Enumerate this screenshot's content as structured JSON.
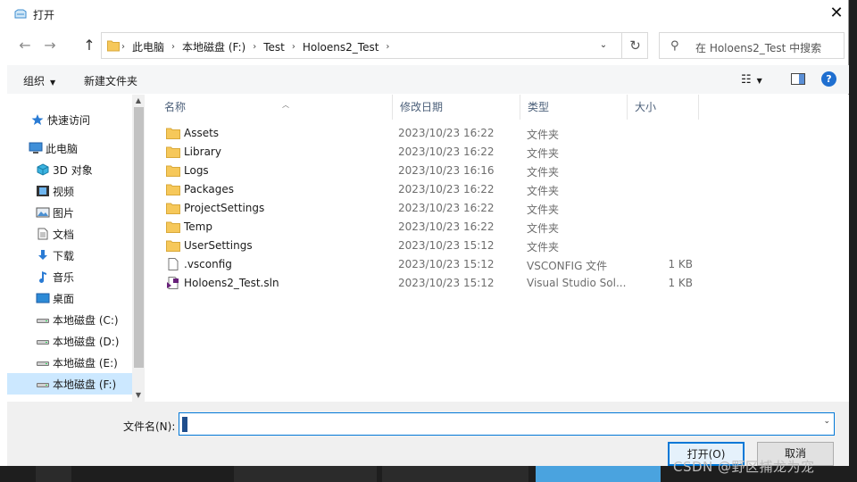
{
  "window": {
    "title": "打开",
    "close_glyph": "✕"
  },
  "nav_buttons": {
    "back": "←",
    "forward": "→",
    "up": "↑"
  },
  "address": {
    "crumbs": [
      "此电脑",
      "本地磁盘 (F:)",
      "Test",
      "Holoens2_Test"
    ],
    "separator": "›",
    "dropdown_glyph": "⌄",
    "refresh_glyph": "↻"
  },
  "search": {
    "placeholder": "在 Holoens2_Test 中搜索",
    "icon_glyph": "⚲"
  },
  "toolbar": {
    "organize": "组织",
    "new_folder": "新建文件夹",
    "view_glyph": "☷",
    "help_glyph": "?"
  },
  "sidebar": {
    "items": [
      {
        "label": "快速访问",
        "icon": "star-icon"
      },
      {
        "label": "此电脑",
        "icon": "computer-icon"
      },
      {
        "label": "3D 对象",
        "icon": "cube-icon"
      },
      {
        "label": "视频",
        "icon": "video-icon"
      },
      {
        "label": "图片",
        "icon": "picture-icon"
      },
      {
        "label": "文档",
        "icon": "document-icon"
      },
      {
        "label": "下载",
        "icon": "download-icon"
      },
      {
        "label": "音乐",
        "icon": "music-icon"
      },
      {
        "label": "桌面",
        "icon": "desktop-icon"
      },
      {
        "label": "本地磁盘 (C:)",
        "icon": "drive-icon"
      },
      {
        "label": "本地磁盘 (D:)",
        "icon": "drive-icon"
      },
      {
        "label": "本地磁盘 (E:)",
        "icon": "drive-icon"
      },
      {
        "label": "本地磁盘 (F:)",
        "icon": "drive-icon",
        "selected": true
      }
    ]
  },
  "columns": {
    "name": "名称",
    "modified": "修改日期",
    "type": "类型",
    "size": "大小"
  },
  "files": [
    {
      "name": "Assets",
      "modified": "2023/10/23 16:22",
      "type": "文件夹",
      "size": "",
      "icon": "folder-icon"
    },
    {
      "name": "Library",
      "modified": "2023/10/23 16:22",
      "type": "文件夹",
      "size": "",
      "icon": "folder-icon"
    },
    {
      "name": "Logs",
      "modified": "2023/10/23 16:16",
      "type": "文件夹",
      "size": "",
      "icon": "folder-icon"
    },
    {
      "name": "Packages",
      "modified": "2023/10/23 16:22",
      "type": "文件夹",
      "size": "",
      "icon": "folder-icon"
    },
    {
      "name": "ProjectSettings",
      "modified": "2023/10/23 16:22",
      "type": "文件夹",
      "size": "",
      "icon": "folder-icon"
    },
    {
      "name": "Temp",
      "modified": "2023/10/23 16:22",
      "type": "文件夹",
      "size": "",
      "icon": "folder-icon"
    },
    {
      "name": "UserSettings",
      "modified": "2023/10/23 15:12",
      "type": "文件夹",
      "size": "",
      "icon": "folder-icon"
    },
    {
      "name": ".vsconfig",
      "modified": "2023/10/23 15:12",
      "type": "VSCONFIG 文件",
      "size": "1 KB",
      "icon": "file-icon"
    },
    {
      "name": "Holoens2_Test.sln",
      "modified": "2023/10/23 15:12",
      "type": "Visual Studio Sol...",
      "size": "1 KB",
      "icon": "vs-solution-icon"
    }
  ],
  "filename": {
    "label": "文件名(N):",
    "value": ""
  },
  "buttons": {
    "open": "打开(O)",
    "cancel": "取消"
  },
  "watermark": "CSDN @野区捕龙为宠",
  "colors": {
    "accent": "#0078d7",
    "folder": "#f6c85a",
    "selection": "#cce8ff"
  }
}
